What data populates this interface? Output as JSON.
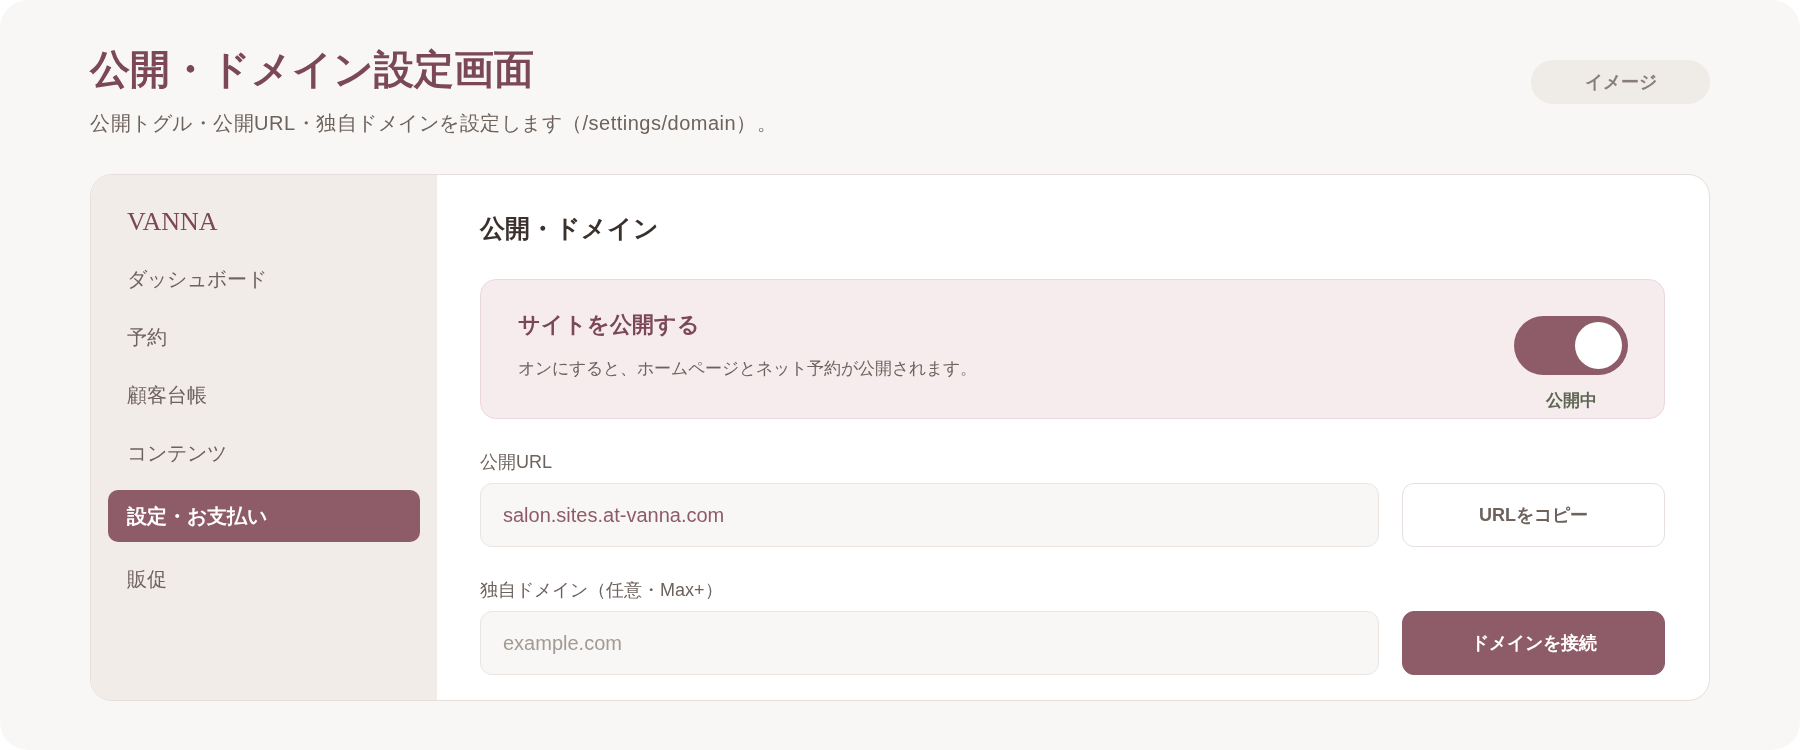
{
  "page": {
    "title": "公開・ドメイン設定画面",
    "subtitle": "公開トグル・公開URL・独自ドメインを設定します（/settings/domain）。",
    "badge": "イメージ"
  },
  "sidebar": {
    "brand": "VANNA",
    "items": [
      {
        "label": "ダッシュボード",
        "selected": false
      },
      {
        "label": "予約",
        "selected": false
      },
      {
        "label": "顧客台帳",
        "selected": false
      },
      {
        "label": "コンテンツ",
        "selected": false
      },
      {
        "label": "設定・お支払い",
        "selected": true
      },
      {
        "label": "販促",
        "selected": false
      }
    ]
  },
  "main": {
    "heading": "公開・ドメイン",
    "publish": {
      "title": "サイトを公開する",
      "description": "オンにすると、ホームページとネット予約が公開されます。",
      "on": true,
      "status": "公開中"
    },
    "fields": [
      {
        "label": "公開URL",
        "value": "salon.sites.at-vanna.com",
        "button": {
          "label": "URLをコピー",
          "kind": "secondary"
        }
      },
      {
        "label": "独自ドメイン（任意・Max+）",
        "placeholder": "example.com",
        "button": {
          "label": "ドメインを接続",
          "kind": "primary"
        }
      }
    ]
  }
}
